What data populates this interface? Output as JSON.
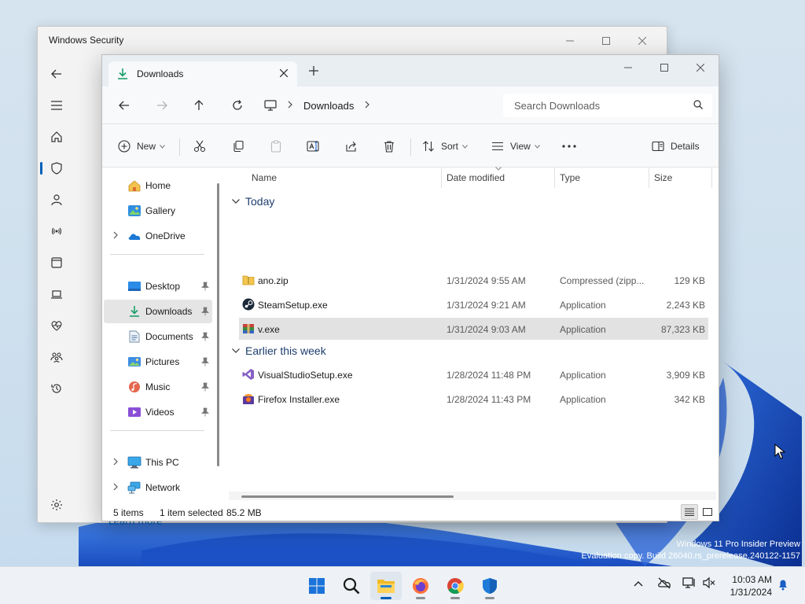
{
  "wallpaper": {
    "watermark_line1": "Windows 11 Pro Insider Preview",
    "watermark_line2": "Evaluation copy. Build 26040.rs_prerelease.240122-1157"
  },
  "security_window": {
    "title": "Windows Security",
    "learn_more": "Learn more",
    "rail_icons": [
      "back-arrow-icon",
      "hamburger-menu-icon",
      "home-icon",
      "shield-icon",
      "account-icon",
      "wireless-icon",
      "app-browser-icon",
      "laptop-icon",
      "heart-pulse-icon",
      "family-icon",
      "history-icon"
    ],
    "active_rail": "shield-icon"
  },
  "explorer": {
    "tab_label": "Downloads",
    "breadcrumb": {
      "location": "Downloads"
    },
    "search": {
      "placeholder": "Search Downloads"
    },
    "toolbar": {
      "new_label": "New",
      "sort_label": "Sort",
      "view_label": "View",
      "more_label": "···",
      "details_label": "Details"
    },
    "nav_pane": {
      "quick": [
        {
          "label": "Home",
          "icon": "home-icon"
        },
        {
          "label": "Gallery",
          "icon": "gallery-icon"
        },
        {
          "label": "OneDrive",
          "icon": "cloud-icon"
        }
      ],
      "pinned": [
        {
          "label": "Desktop",
          "icon": "desktop-folder-icon"
        },
        {
          "label": "Downloads",
          "icon": "downloads-icon"
        },
        {
          "label": "Documents",
          "icon": "documents-icon"
        },
        {
          "label": "Pictures",
          "icon": "pictures-icon"
        },
        {
          "label": "Music",
          "icon": "music-icon"
        },
        {
          "label": "Videos",
          "icon": "videos-icon"
        }
      ],
      "devices": [
        {
          "label": "This PC",
          "icon": "computer-icon"
        },
        {
          "label": "Network",
          "icon": "network-icon"
        }
      ]
    },
    "columns": {
      "name": "Name",
      "date": "Date modified",
      "type": "Type",
      "size": "Size"
    },
    "groups": [
      {
        "label": "Today",
        "files": [
          {
            "name": "ano.zip",
            "date": "1/31/2024 9:55 AM",
            "type": "Compressed (zipp...",
            "size": "129 KB",
            "icon": "zip-folder-icon",
            "selected": false
          },
          {
            "name": "SteamSetup.exe",
            "date": "1/31/2024 9:21 AM",
            "type": "Application",
            "size": "2,243 KB",
            "icon": "steam-icon",
            "selected": false
          },
          {
            "name": "v.exe",
            "date": "1/31/2024 9:03 AM",
            "type": "Application",
            "size": "87,323 KB",
            "icon": "installer-box-icon",
            "selected": true
          }
        ]
      },
      {
        "label": "Earlier this week",
        "files": [
          {
            "name": "VisualStudioSetup.exe",
            "date": "1/28/2024 11:48 PM",
            "type": "Application",
            "size": "3,909 KB",
            "icon": "visual-studio-icon",
            "selected": false
          },
          {
            "name": "Firefox Installer.exe",
            "date": "1/28/2024 11:43 PM",
            "type": "Application",
            "size": "342 KB",
            "icon": "firefox-installer-icon",
            "selected": false
          }
        ]
      }
    ],
    "status": {
      "item_count": "5 items",
      "selection": "1 item selected",
      "selection_size": "85.2 MB"
    }
  },
  "taskbar": {
    "apps": [
      "start-icon",
      "search-icon",
      "file-explorer-icon",
      "firefox-icon",
      "chrome-icon",
      "windows-security-icon"
    ],
    "clock_time": "10:03 AM",
    "clock_date": "1/31/2024"
  },
  "colors": {
    "accent": "#005fb8",
    "selection": "#e2e2e2"
  }
}
